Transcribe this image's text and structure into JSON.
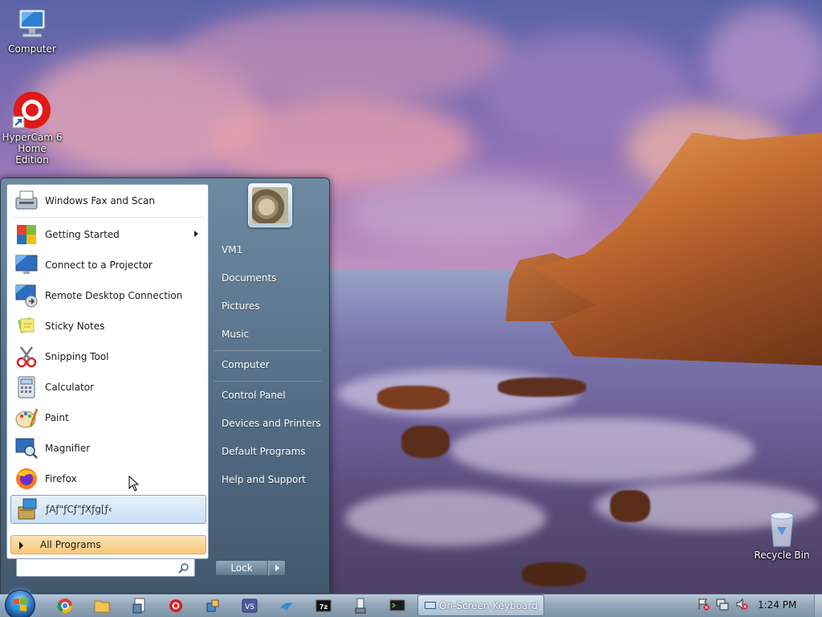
{
  "desktop": {
    "icons": [
      {
        "label": "Computer",
        "icon": "computer-icon"
      },
      {
        "label": "HyperCam 6",
        "label2": "Home Edition",
        "icon": "hypercam-icon"
      },
      {
        "label": "Recycle Bin",
        "icon": "recycle-bin-icon"
      }
    ]
  },
  "start_menu": {
    "programs": [
      {
        "label": "Windows Fax and Scan",
        "icon": "fax-scan-icon"
      },
      {
        "label": "Getting Started",
        "icon": "getting-started-icon",
        "has_submenu": true
      },
      {
        "label": "Connect to a Projector",
        "icon": "projector-icon"
      },
      {
        "label": "Remote Desktop Connection",
        "icon": "remote-desktop-icon"
      },
      {
        "label": "Sticky Notes",
        "icon": "sticky-notes-icon"
      },
      {
        "label": "Snipping Tool",
        "icon": "snipping-tool-icon"
      },
      {
        "label": "Calculator",
        "icon": "calculator-icon"
      },
      {
        "label": "Paint",
        "icon": "paint-icon"
      },
      {
        "label": "Magnifier",
        "icon": "magnifier-icon"
      },
      {
        "label": "Firefox",
        "icon": "firefox-icon"
      },
      {
        "label": "ƒAƒ\"ƒCƒ\"ƒXƒg[ƒ‹",
        "icon": "installer-icon",
        "highlighted": true
      }
    ],
    "all_programs": "All Programs",
    "search_placeholder": "",
    "user_name": "VM1",
    "right_items": [
      {
        "label": "VM1"
      },
      {
        "label": "Documents"
      },
      {
        "label": "Pictures"
      },
      {
        "label": "Music"
      },
      {
        "label": "Computer"
      },
      {
        "label": "Control Panel"
      },
      {
        "label": "Devices and Printers"
      },
      {
        "label": "Default Programs"
      },
      {
        "label": "Help and Support"
      }
    ],
    "lock_label": "Lock"
  },
  "taskbar": {
    "pinned": [
      "chrome-icon",
      "explorer-icon",
      "document-tool-icon",
      "hypercam-icon",
      "network-tool-icon",
      "visual-studio-icon",
      "bird-app-icon",
      "7zip-icon",
      "usb-tool-icon",
      "terminal-icon"
    ],
    "open_window": "On-Screen Keyboard",
    "clock": "1:24 PM"
  },
  "colors": {
    "taskbar": "#93a7ba",
    "start_menu": "#536d86",
    "all_programs_highlight": "#f7c77a",
    "selection": "#c9e0f6"
  }
}
